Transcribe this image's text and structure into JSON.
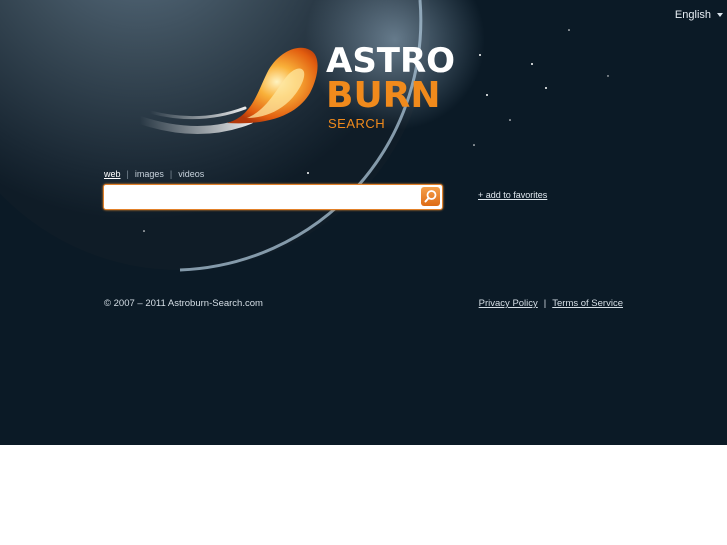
{
  "header": {
    "language": "English"
  },
  "logo": {
    "line1": "ASTRO",
    "line2": "BURN",
    "line3": "SEARCH"
  },
  "search": {
    "tabs": [
      {
        "label": "web",
        "active": true
      },
      {
        "label": "images",
        "active": false
      },
      {
        "label": "videos",
        "active": false
      }
    ],
    "query": "",
    "add_favorites": "+ add to favorites"
  },
  "footer": {
    "copyright": "© 2007 – 2011 Astroburn-Search.com",
    "privacy": "Privacy Policy",
    "separator": "|",
    "terms": "Terms of Service"
  },
  "colors": {
    "background": "#0b1a26",
    "accent": "#f08a1c",
    "search_border": "#e2812a"
  },
  "icons": {
    "search": "search-icon",
    "language_caret": "caret-down-icon",
    "logo_flame": "flame-icon"
  }
}
